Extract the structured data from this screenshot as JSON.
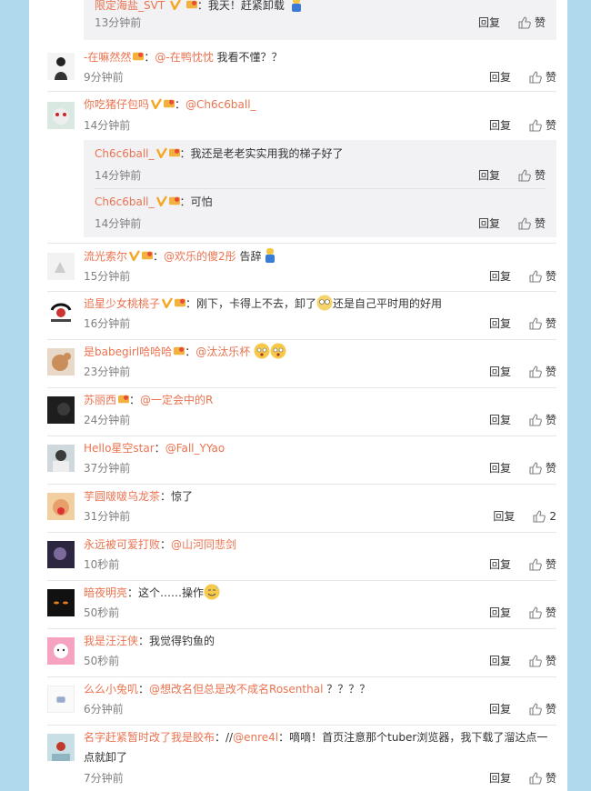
{
  "reply_label": "回复",
  "like_label": "赞",
  "top_sub": {
    "user": "限定海盐_SVT",
    "text": "：我天！赶紧卸载",
    "time": "13分钟前"
  },
  "comments": [
    {
      "user": "-在嘛然然",
      "mention": "@-在鸭忱忱",
      "text": " 我看不懂？？",
      "time": "9分钟前"
    },
    {
      "user": "你吃猪仔包吗",
      "mention": "@Ch6c6ball_",
      "text": "",
      "time": "14分钟前"
    },
    {
      "user": "流光索尔",
      "mention": "@欢乐的傻2彤",
      "text": " 告辞",
      "time": "15分钟前"
    },
    {
      "user": "追星少女桃桃子",
      "text1": "：刚下，卡得上不去，卸了",
      "text2": "还是自己平时用的好用",
      "time": "16分钟前"
    },
    {
      "user": "是babegirl哈哈哈",
      "mention": "@汰汰乐杯",
      "time": "23分钟前"
    },
    {
      "user": "苏丽西",
      "mention": "@一定会中的R",
      "time": "24分钟前"
    },
    {
      "user": "Hello星空star",
      "mention": "@Fall_YYao",
      "time": "37分钟前"
    },
    {
      "user": "芋圆啵啵乌龙茶",
      "text": "：惊了",
      "time": "31分钟前",
      "likes": "2"
    },
    {
      "user": "永远被可爱打败",
      "mention": "@山河同悲剑",
      "time": "10秒前"
    },
    {
      "user": "暗夜明亮",
      "text": "：这个……操作",
      "time": "50秒前"
    },
    {
      "user": "我是汪汪侠",
      "text": "：我觉得钓鱼的",
      "time": "50秒前"
    },
    {
      "user": "么么小兔叽",
      "mention": "@想改名但总是改不成名Rosenthal",
      "text": " ？？？？",
      "time": "6分钟前"
    },
    {
      "user": "名字赶紧暂时改了我是胶布",
      "text1": "：//",
      "mention": "@enre4l",
      "text2": "：嘀嘀！首页注意那个tuber浏览器，我下载了溜达点一点就卸了",
      "time": "7分钟前"
    }
  ],
  "sub_replies": [
    {
      "user": "Ch6c6ball_",
      "text": "：我还是老老实实用我的梯子好了",
      "time": "14分钟前"
    },
    {
      "user": "Ch6c6ball_",
      "text": "：可怕",
      "time": "14分钟前"
    }
  ]
}
